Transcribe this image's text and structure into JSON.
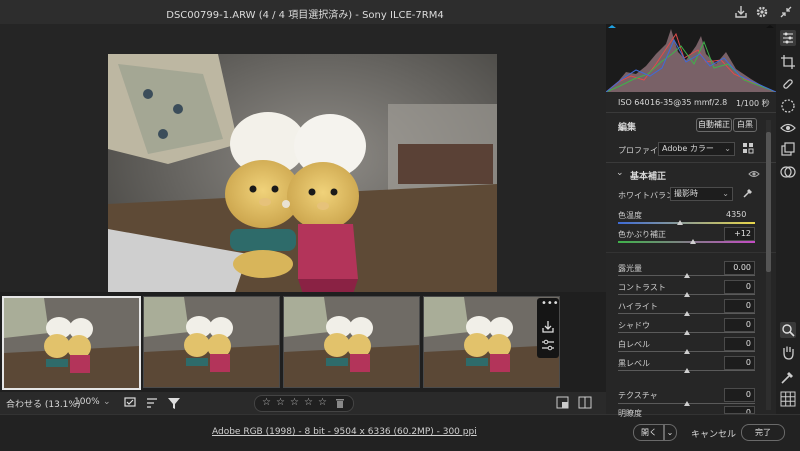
{
  "window": {
    "title": "DSC00799-1.ARW (4 / 4 項目選択済み) - Sony ILCE-7RM4"
  },
  "camera_info": {
    "iso": "ISO 640",
    "lens": "16-35@35 mm",
    "aperture": "f/2.8",
    "shutter": "1/100 秒"
  },
  "panel": {
    "section_title": "編集",
    "auto_button": "自動補正",
    "bw_button": "白黒",
    "profile_label": "プロファイル",
    "profile_value": "Adobe カラー",
    "basic_section": "基本補正",
    "white_balance_label": "ホワイトバランス",
    "white_balance_value": "撮影時",
    "temp": {
      "label": "色温度",
      "value": "4350",
      "level": 0.45
    },
    "tint": {
      "label": "色かぶり補正",
      "value": "+12",
      "level": 0.55
    },
    "sliders": [
      {
        "label": "露光量",
        "value": "0.00",
        "level": 0.5
      },
      {
        "label": "コントラスト",
        "value": "0",
        "level": 0.5
      },
      {
        "label": "ハイライト",
        "value": "0",
        "level": 0.5
      },
      {
        "label": "シャドウ",
        "value": "0",
        "level": 0.5
      },
      {
        "label": "白レベル",
        "value": "0",
        "level": 0.5
      },
      {
        "label": "黒レベル",
        "value": "0",
        "level": 0.5
      }
    ],
    "texture": {
      "label": "テクスチャ",
      "value": "0",
      "level": 0.5
    },
    "clarity": {
      "label": "明瞭度",
      "value": "0"
    }
  },
  "bottom": {
    "fit_label": "合わせる (13.1%)",
    "zoom_value": "100%",
    "stars": [
      "☆",
      "☆",
      "☆",
      "☆",
      "☆"
    ]
  },
  "status": {
    "file_info": "Adobe RGB (1998) - 8 bit - 9504 x 6336 (60.2MP) - 300 ppi",
    "open_button": "開く",
    "cancel_button": "キャンセル",
    "done_button": "完了"
  },
  "colors": {
    "accent": "#1fa0e0",
    "panel_bg": "#262626"
  }
}
